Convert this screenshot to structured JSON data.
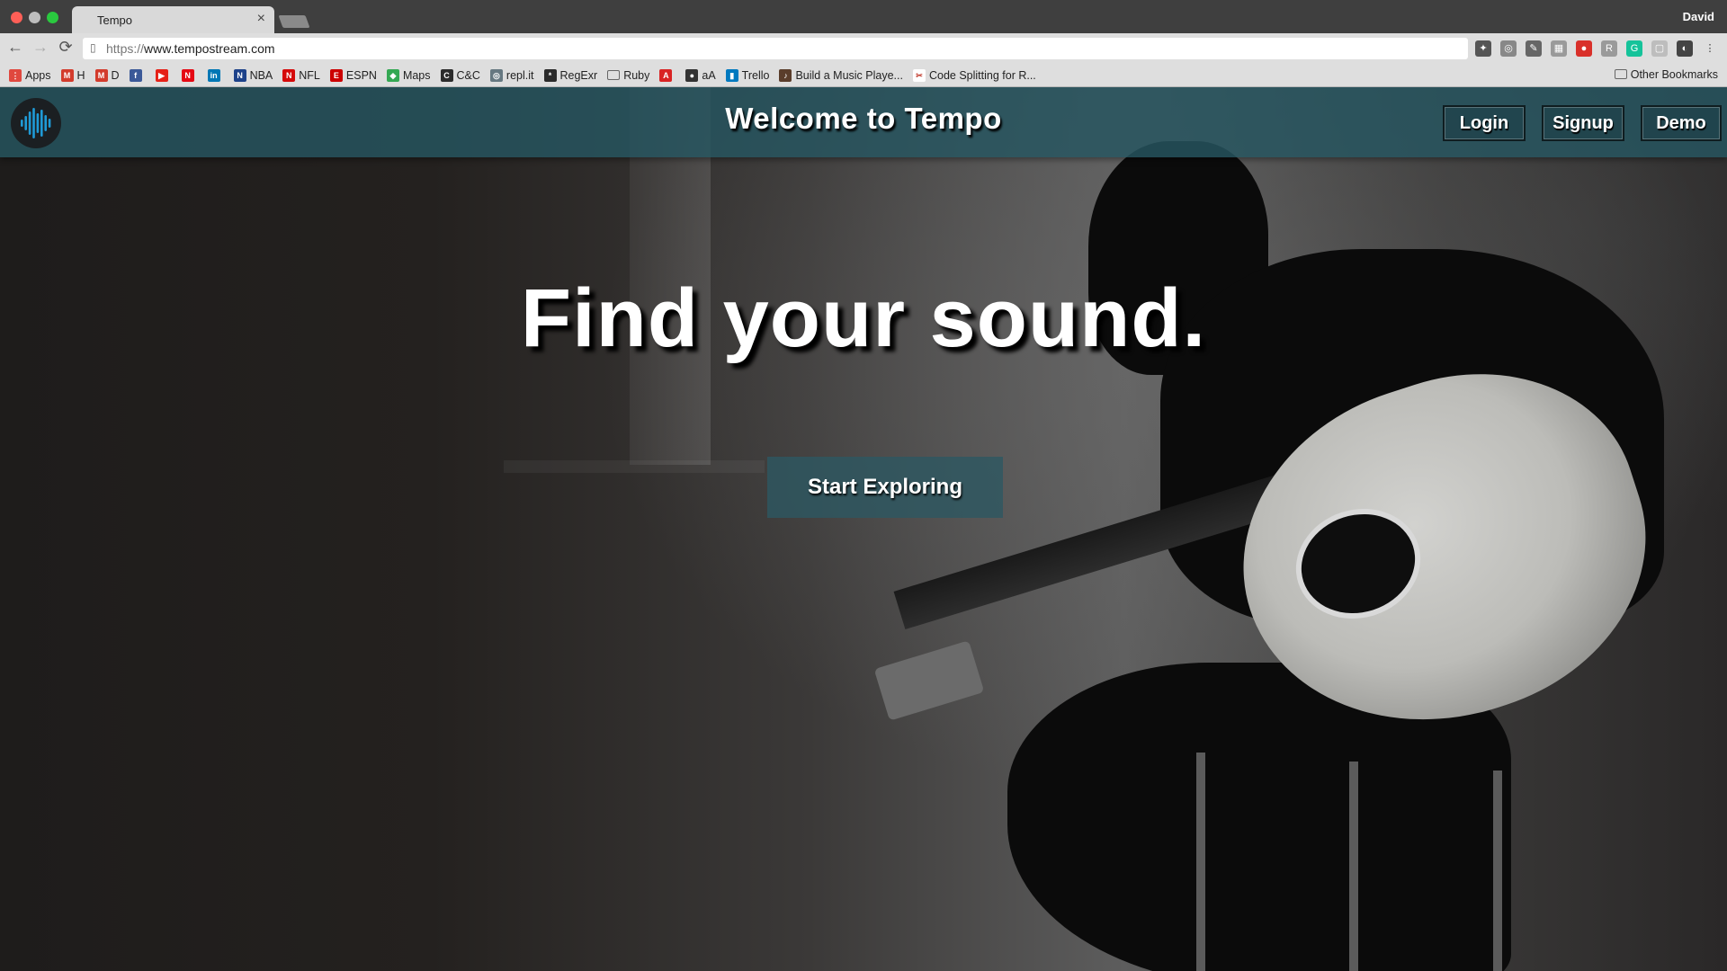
{
  "browser": {
    "tab_title": "Tempo",
    "tab_close": "×",
    "profile_name": "David",
    "url_scheme": "https://",
    "url_host": "www.tempostream.com",
    "nav": {
      "back": "←",
      "forward": "→",
      "reload": "⟳"
    },
    "bookmarks": [
      {
        "label": "Apps",
        "color": "#e0483e",
        "glyph": "⋮"
      },
      {
        "label": "H",
        "color": "#d33b2c",
        "glyph": "M"
      },
      {
        "label": "D",
        "color": "#d33b2c",
        "glyph": "M"
      },
      {
        "label": "",
        "color": "#3b5998",
        "glyph": "f"
      },
      {
        "label": "",
        "color": "#e62117",
        "glyph": "▶"
      },
      {
        "label": "",
        "color": "#e50914",
        "glyph": "N"
      },
      {
        "label": "",
        "color": "#0077b5",
        "glyph": "in"
      },
      {
        "label": "NBA",
        "color": "#1d428a",
        "glyph": "N"
      },
      {
        "label": "NFL",
        "color": "#d50a0a",
        "glyph": "N"
      },
      {
        "label": "ESPN",
        "color": "#cc0000",
        "glyph": "E"
      },
      {
        "label": "Maps",
        "color": "#34a853",
        "glyph": "◆"
      },
      {
        "label": "C&C",
        "color": "#2c2c2c",
        "glyph": "C"
      },
      {
        "label": "repl.it",
        "color": "#667881",
        "glyph": "◎"
      },
      {
        "label": "RegExr",
        "color": "#2b2b2b",
        "glyph": "*"
      },
      {
        "label": "Ruby",
        "color": "folder",
        "glyph": ""
      },
      {
        "label": "",
        "color": "#d92323",
        "glyph": "A"
      },
      {
        "label": "aA",
        "color": "#333333",
        "glyph": "●"
      },
      {
        "label": "Trello",
        "color": "#0079bf",
        "glyph": "▮"
      },
      {
        "label": "Build a Music Playe...",
        "color": "#5a3d2b",
        "glyph": "♪"
      },
      {
        "label": "Code Splitting for R...",
        "color": "#ffffff",
        "glyph": "✂"
      }
    ],
    "other_bookmarks": "Other Bookmarks",
    "extensions": [
      {
        "name": "puzzle-icon",
        "color": "#555555",
        "glyph": "✦"
      },
      {
        "name": "globe-icon",
        "color": "#888888",
        "glyph": "◎"
      },
      {
        "name": "pen-icon",
        "color": "#666666",
        "glyph": "✎"
      },
      {
        "name": "grid-icon",
        "color": "#9a9a9a",
        "glyph": "▦"
      },
      {
        "name": "video-icon",
        "color": "#d9302a",
        "glyph": "●"
      },
      {
        "name": "r-icon",
        "color": "#9a9a9a",
        "glyph": "R"
      },
      {
        "name": "grammarly-icon",
        "color": "#15c39a",
        "glyph": "G"
      },
      {
        "name": "square-icon",
        "color": "#bdbdbd",
        "glyph": "▢"
      },
      {
        "name": "circle-icon",
        "color": "#444444",
        "glyph": "◐"
      },
      {
        "name": "menu-icon",
        "color": "#dedede",
        "glyph": "⋮"
      }
    ]
  },
  "site": {
    "title": "Welcome to Tempo",
    "nav": {
      "login": "Login",
      "signup": "Signup",
      "demo": "Demo"
    },
    "hero_title": "Find your sound.",
    "cta_label": "Start Exploring",
    "accent_color": "#1f9ad6"
  }
}
